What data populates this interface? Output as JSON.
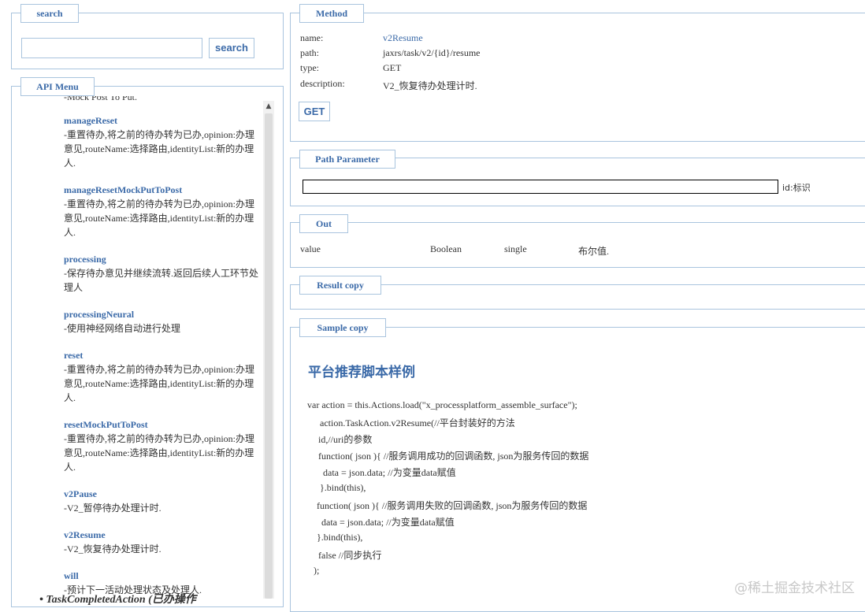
{
  "search": {
    "legend": "search",
    "input_value": "",
    "button_label": "search"
  },
  "api_menu": {
    "legend": "API Menu",
    "partial_top_desc": "-Mock Post To Put.",
    "items": [
      {
        "name": "manageReset",
        "desc": "-重置待办,将之前的待办转为已办,opinion:办理意见,routeName:选择路由,identityList:新的办理人."
      },
      {
        "name": "manageResetMockPutToPost",
        "desc": "-重置待办,将之前的待办转为已办,opinion:办理意见,routeName:选择路由,identityList:新的办理人."
      },
      {
        "name": "processing",
        "desc": "-保存待办意见并继续流转.返回后续人工环节处理人"
      },
      {
        "name": "processingNeural",
        "desc": "-使用神经网络自动进行处理"
      },
      {
        "name": "reset",
        "desc": "-重置待办,将之前的待办转为已办,opinion:办理意见,routeName:选择路由,identityList:新的办理人."
      },
      {
        "name": "resetMockPutToPost",
        "desc": "-重置待办,将之前的待办转为已办,opinion:办理意见,routeName:选择路由,identityList:新的办理人."
      },
      {
        "name": "v2Pause",
        "desc": "-V2_暂停待办处理计时."
      },
      {
        "name": "v2Resume",
        "desc": "-V2_恢复待办处理计时."
      },
      {
        "name": "will",
        "desc": "-预计下一活动处理状态及处理人."
      }
    ],
    "next_group": "TaskCompletedAction (已办操作"
  },
  "method": {
    "legend": "Method",
    "name_label": "name:",
    "name_value": "v2Resume",
    "path_label": "path:",
    "path_value": "jaxrs/task/v2/{id}/resume",
    "type_label": "type:",
    "type_value": "GET",
    "description_label": "description:",
    "description_value": "V2_恢复待办处理计时.",
    "button_label": "GET"
  },
  "path_parameter": {
    "legend": "Path Parameter",
    "input_value": "",
    "param_label": "id:标识"
  },
  "out": {
    "legend": "Out",
    "field": "value",
    "type": "Boolean",
    "mode": "single",
    "desc": "布尔值."
  },
  "result": {
    "legend": "Result copy"
  },
  "sample": {
    "legend": "Sample copy",
    "title": "平台推荐脚本样例",
    "code": [
      "var action = this.Actions.load(\"x_processplatform_assemble_surface\");",
      "    action.TaskAction.v2Resume(//平台封装好的方法",
      "    id,//uri的参数",
      "    function( json ){ //服务调用成功的回调函数, json为服务传回的数据",
      "        data = json.data; //为变量data赋值",
      "    }.bind(this),",
      "    function( json ){ //服务调用失败的回调函数, json为服务传回的数据",
      "        data = json.data; //为变量data赋值",
      "    }.bind(this),",
      "    false //同步执行",
      "    );"
    ]
  },
  "watermark": "@稀土掘金技术社区"
}
